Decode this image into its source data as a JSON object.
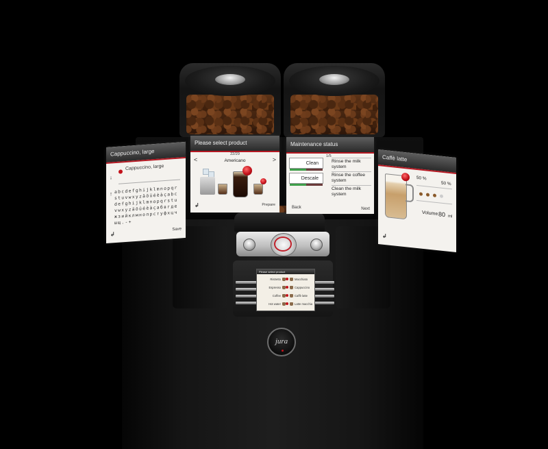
{
  "screen_select_main": {
    "title": "Please select product",
    "items": [
      {
        "label": "Ristretto",
        "side": "left"
      },
      {
        "label": "Macchiato",
        "side": "right"
      },
      {
        "label": "Espresso",
        "side": "left"
      },
      {
        "label": "Cappuccino",
        "side": "right"
      },
      {
        "label": "Coffee",
        "side": "left"
      },
      {
        "label": "Caffè latte",
        "side": "right"
      },
      {
        "label": "Hot water",
        "side": "left"
      },
      {
        "label": "Latte macchiato",
        "side": "right"
      }
    ]
  },
  "logo": {
    "text": "jura"
  },
  "screen_name_edit": {
    "title": "Cappuccino, large",
    "current_name": "Cappuccino, large",
    "char_table": "abcdefghijklmnopqrstuvwxyzäöüéèàçabcdefghijklmnopqrstuvwxyzäöüéèàçабвгдежзийклмнопрстуфхцчшщ.-+",
    "back": "↲",
    "save": "Save"
  },
  "screen_product": {
    "title": "Please select product",
    "page": "22/29",
    "product": "Americano",
    "nav_left": "<",
    "nav_right": ">",
    "back": "↲",
    "prepare": "Prepare"
  },
  "screen_maintenance": {
    "title": "Maintenance status",
    "count": "1/5",
    "buttons": [
      "Clean",
      "Descale"
    ],
    "tasks": [
      "Rinse the milk system",
      "Rinse the coffee system",
      "Clean the milk system"
    ],
    "back": "Back",
    "next": "Next"
  },
  "screen_latte": {
    "title": "Caffè latte",
    "milk_pct": "50 %",
    "coffee_pct": "50 %",
    "strength": 3,
    "volume_label": "Volume",
    "volume_value": "80",
    "volume_unit": "ml",
    "back": "↲"
  },
  "colors": {
    "accent": "#c3121b",
    "background": "#000000"
  }
}
